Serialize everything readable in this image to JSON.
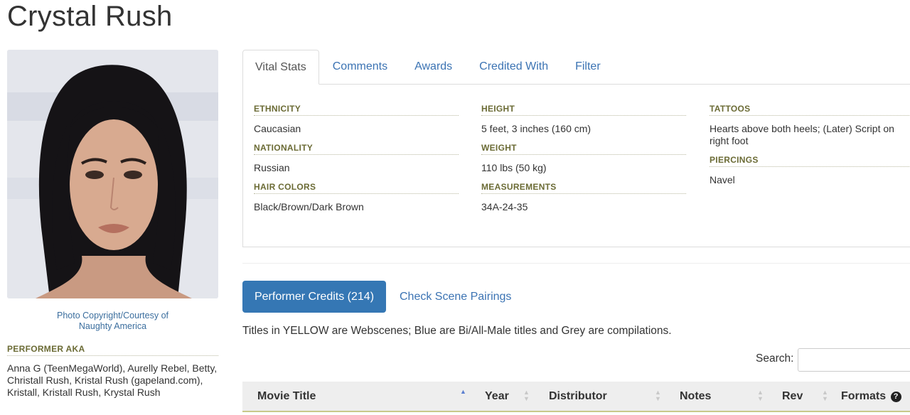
{
  "page": {
    "title": "Crystal Rush"
  },
  "photo": {
    "credit_line1": "Photo Copyright/Courtesy of",
    "credit_line2": "Naughty America"
  },
  "aka": {
    "heading": "PERFORMER AKA",
    "text": "Anna G (TeenMegaWorld), Aurelly Rebel, Betty, Christall Rush, Kristal Rush (gapeland.com), Kristall, Kristall Rush, Krystal Rush"
  },
  "tabs": [
    {
      "label": "Vital Stats",
      "active": true
    },
    {
      "label": "Comments"
    },
    {
      "label": "Awards"
    },
    {
      "label": "Credited With"
    },
    {
      "label": "Filter"
    }
  ],
  "vital_stats": {
    "col1": [
      {
        "label": "ETHNICITY",
        "value": "Caucasian"
      },
      {
        "label": "NATIONALITY",
        "value": "Russian"
      },
      {
        "label": "HAIR COLORS",
        "value": "Black/Brown/Dark Brown"
      }
    ],
    "col2": [
      {
        "label": "HEIGHT",
        "value": "5 feet, 3 inches (160 cm)"
      },
      {
        "label": "WEIGHT",
        "value": "110 lbs (50 kg)"
      },
      {
        "label": "MEASUREMENTS",
        "value": "34A-24-35"
      }
    ],
    "col3": [
      {
        "label": "TATTOOS",
        "value": "Hearts above both heels; (Later) Script on right foot"
      },
      {
        "label": "PIERCINGS",
        "value": "Navel"
      }
    ]
  },
  "credits": {
    "button_label": "Performer Credits (214)",
    "pairings_link": "Check Scene Pairings",
    "legend_note": "Titles in YELLOW are Webscenes; Blue are Bi/All-Male titles and Grey are compilations.",
    "search_label": "Search:",
    "search_value": "",
    "columns": [
      "Movie Title",
      "Year",
      "Distributor",
      "Notes",
      "Rev",
      "Formats"
    ]
  },
  "colors": {
    "accent": "#3577b4",
    "link": "#3b73b3",
    "label": "#6b6b35"
  }
}
